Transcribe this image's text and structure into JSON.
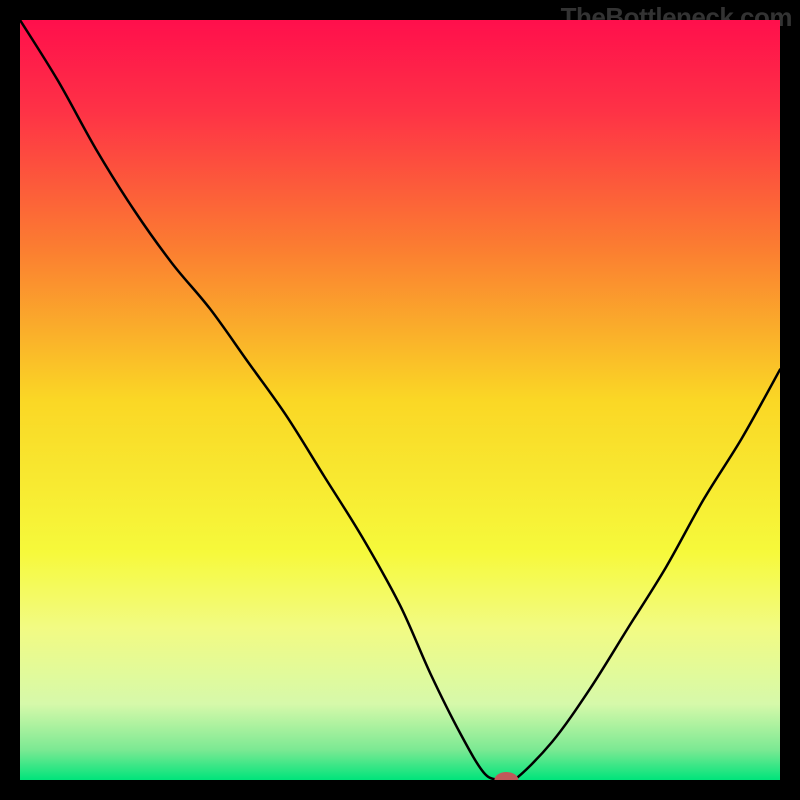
{
  "attribution": "TheBottleneck.com",
  "chart_data": {
    "type": "line",
    "title": "",
    "xlabel": "",
    "ylabel": "",
    "xlim": [
      0,
      100
    ],
    "ylim": [
      0,
      100
    ],
    "legend": false,
    "grid": false,
    "gradient_stops": [
      {
        "offset": 0.0,
        "color": "#ff0f4c"
      },
      {
        "offset": 0.12,
        "color": "#fe3246"
      },
      {
        "offset": 0.3,
        "color": "#fb7d31"
      },
      {
        "offset": 0.5,
        "color": "#fad725"
      },
      {
        "offset": 0.7,
        "color": "#f6f93b"
      },
      {
        "offset": 0.8,
        "color": "#f2fb83"
      },
      {
        "offset": 0.9,
        "color": "#d6f9aa"
      },
      {
        "offset": 0.96,
        "color": "#7ce993"
      },
      {
        "offset": 1.0,
        "color": "#00e47b"
      }
    ],
    "series": [
      {
        "name": "curve",
        "x": [
          0,
          5,
          10,
          15,
          20,
          25,
          30,
          35,
          40,
          45,
          50,
          54,
          58,
          61,
          63,
          65,
          70,
          75,
          80,
          85,
          90,
          95,
          100
        ],
        "y": [
          100,
          92,
          83,
          75,
          68,
          62,
          55,
          48,
          40,
          32,
          23,
          14,
          6,
          1,
          0,
          0,
          5,
          12,
          20,
          28,
          37,
          45,
          54
        ]
      }
    ],
    "marker": {
      "x": 64,
      "y": 0,
      "color": "#c05a5a",
      "rx": 12,
      "ry": 8
    }
  }
}
